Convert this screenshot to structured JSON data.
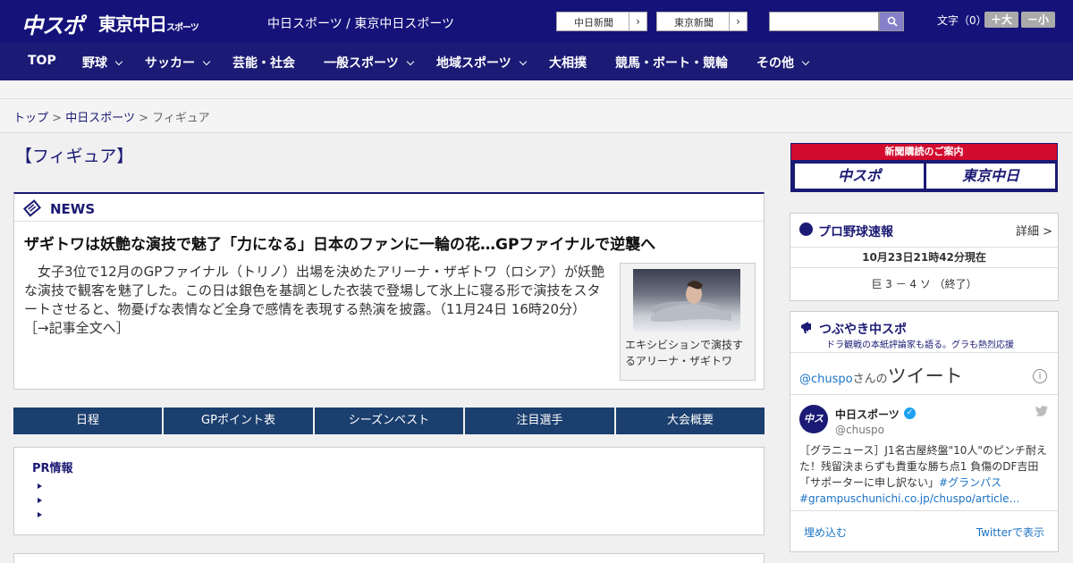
{
  "header": {
    "logo_main": "中スポ",
    "logo_tokyo": "東京中日",
    "logo_tokyo_small": "スポーツ",
    "site_name": "中日スポーツ / 東京中日スポーツ",
    "paper_links": [
      {
        "label": "中日新聞"
      },
      {
        "label": "東京新聞"
      }
    ],
    "search": {
      "placeholder": "",
      "value": ""
    },
    "font_size_label": "文字（0）",
    "font_larger": "＋大",
    "font_smaller": "－小"
  },
  "nav": {
    "items": [
      {
        "label": "TOP",
        "dropdown": false
      },
      {
        "label": "野球",
        "dropdown": true
      },
      {
        "label": "サッカー",
        "dropdown": true
      },
      {
        "label": "芸能・社会",
        "dropdown": false
      },
      {
        "label": "一般スポーツ",
        "dropdown": true
      },
      {
        "label": "地域スポーツ",
        "dropdown": true
      },
      {
        "label": "大相撲",
        "dropdown": false
      },
      {
        "label": "競馬・ボート・競輪",
        "dropdown": false
      },
      {
        "label": "その他",
        "dropdown": true
      }
    ]
  },
  "breadcrumb": {
    "items": [
      {
        "label": "トップ"
      },
      {
        "label": "中日スポーツ"
      },
      {
        "label": "フィギュア"
      }
    ],
    "separator": ">"
  },
  "page": {
    "title": "【フィギュア】"
  },
  "news": {
    "section_label": "NEWS",
    "headline": "ザギトワは妖艶な演技で魅了「力になる」日本のファンに一輪の花…GPファイナルで逆襲へ",
    "body": "女子3位で12月のGPファイナル（トリノ）出場を決めたアリーナ・ザギトワ（ロシア）が妖艶な演技で観客を魅了した。この日は銀色を基調とした衣装で登場して氷上に寝る形で演技をスタートさせると、物憂げな表情など全身で感情を表現する熱演を披露。（11月24日 16時20分）",
    "read_more": "［→記事全文へ］",
    "photo_caption": "エキシビションで演技するアリーナ・ザギトワ"
  },
  "tabs": [
    {
      "label": "日程"
    },
    {
      "label": "GPポイント表"
    },
    {
      "label": "シーズンベスト"
    },
    {
      "label": "注目選手"
    },
    {
      "label": "大会概要"
    }
  ],
  "pr": {
    "title": "PR情報",
    "items": [
      "",
      "",
      ""
    ]
  },
  "sidebar": {
    "subscribe": {
      "banner": "新聞購読のご案内",
      "left": "中スポ",
      "right": "東京中日"
    },
    "baseball": {
      "title": "プロ野球速報",
      "detail": "詳細 >",
      "timestamp": "10月23日21時42分現在",
      "score": "巨 3 － 4 ソ （終了）"
    },
    "tweets": {
      "title": "つぶやき中スポ",
      "subtitle": "ドラ観戦の本紙評論家も語る。グラも熱烈応援",
      "handle_prefix": "@chuspo",
      "handle_suffix": "さんの",
      "tweet_word": "ツイート",
      "account_name": "中日スポーツ",
      "account_handle": "@chuspo",
      "avatar_text": "中スポ",
      "tweet_text": "［グラニュース］J1名古屋終盤\"10人\"のピンチ耐えた！残留決まらずも貴重な勝ち点1 負傷のDF吉田「サポーターに申し訳ない」",
      "hashtag": "#グランパス",
      "link": "#grampuschunichi.co.jp/chuspo/article…",
      "embed": "埋め込む",
      "view_on_twitter": "Twitterで表示"
    }
  },
  "colors": {
    "brand_navy": "#15127a",
    "nav_navy": "#1b1a74",
    "tab_blue": "#1b3f6e",
    "subscribe_red": "#d10a2e",
    "twitter_blue": "#1b73c6"
  }
}
